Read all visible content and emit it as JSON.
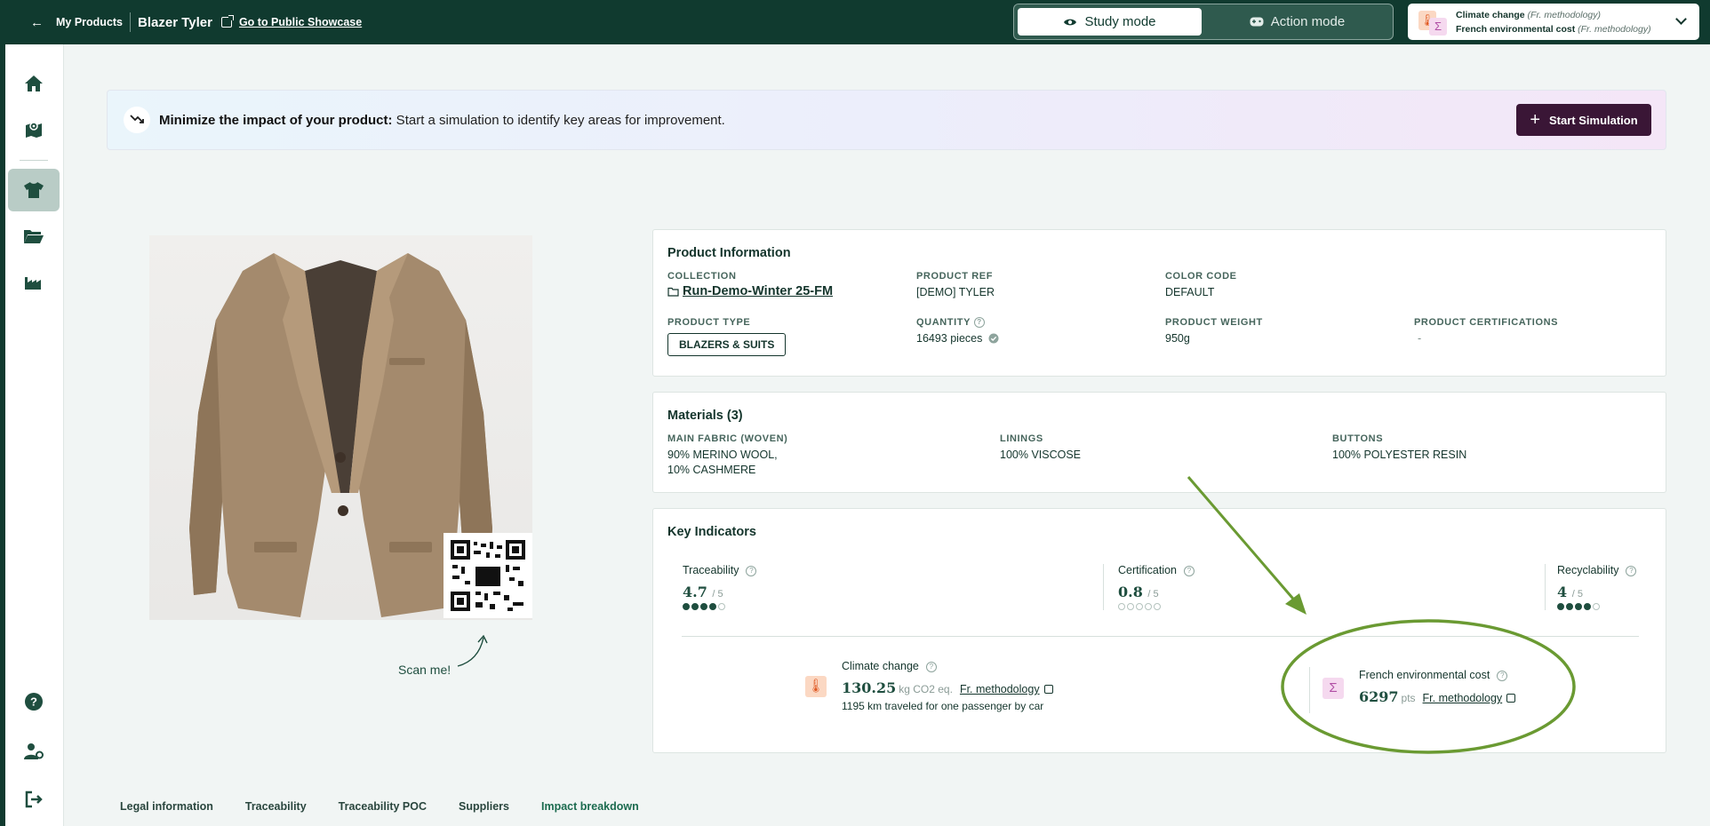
{
  "topbar": {
    "back_label": "My Products",
    "product_name": "Blazer Tyler",
    "public_link": "Go to Public Showcase",
    "study_mode": "Study mode",
    "action_mode": "Action mode",
    "indicator_line1": "Climate change",
    "indicator_line1_note": "(Fr. methodology)",
    "indicator_line2": "French environmental cost",
    "indicator_line2_note": "(Fr. methodology)"
  },
  "sidebar": {
    "items": [
      "home-icon",
      "map-icon",
      "tshirt-icon",
      "folder-icon",
      "factory-icon",
      "help-icon",
      "user-settings-icon",
      "logout-icon"
    ]
  },
  "banner": {
    "bold": "Minimize the impact of your product:",
    "text": " Start a simulation to identify key areas for improvement.",
    "button": "Start Simulation"
  },
  "image": {
    "scan_label": "Scan me!"
  },
  "product_info": {
    "title": "Product Information",
    "collection_label": "COLLECTION",
    "collection_value": "Run-Demo-Winter 25-FM",
    "ref_label": "PRODUCT REF",
    "ref_value": "[DEMO] TYLER",
    "color_label": "COLOR CODE",
    "color_value": "DEFAULT",
    "type_label": "PRODUCT TYPE",
    "type_value": "BLAZERS & SUITS",
    "quantity_label": "QUANTITY",
    "quantity_value": "16493 pieces",
    "weight_label": "PRODUCT WEIGHT",
    "weight_value": "950g",
    "cert_label": "PRODUCT CERTIFICATIONS",
    "cert_value": "-"
  },
  "materials": {
    "title": "Materials (3)",
    "items": [
      {
        "label": "MAIN FABRIC (WOVEN)",
        "value1": "90% MERINO WOOL,",
        "value2": "10% CASHMERE"
      },
      {
        "label": "LININGS",
        "value1": "100% VISCOSE"
      },
      {
        "label": "BUTTONS",
        "value1": "100% POLYESTER RESIN"
      }
    ]
  },
  "key_indicators": {
    "title": "Key Indicators",
    "traceability": {
      "label": "Traceability",
      "value": "4.7",
      "max": "/ 5"
    },
    "certification": {
      "label": "Certification",
      "value": "0.8",
      "max": "/ 5"
    },
    "recyclability": {
      "label": "Recyclability",
      "value": "4",
      "max": "/ 5"
    },
    "climate": {
      "label": "Climate change",
      "value": "130.25",
      "unit": "kg CO2 eq.",
      "methodology": "Fr. methodology",
      "equivalent": "1195 km traveled for one passenger by car"
    },
    "french_cost": {
      "label": "French environmental cost",
      "value": "6297",
      "unit": "pts",
      "methodology": "Fr. methodology"
    }
  },
  "tabs": [
    "Legal information",
    "Traceability",
    "Traceability POC",
    "Suppliers",
    "Impact breakdown"
  ],
  "colors": {
    "header": "#103a2f",
    "accent": "#1f4e3f",
    "simulation_button": "#3a1636",
    "annotation": "#6a9a32"
  }
}
